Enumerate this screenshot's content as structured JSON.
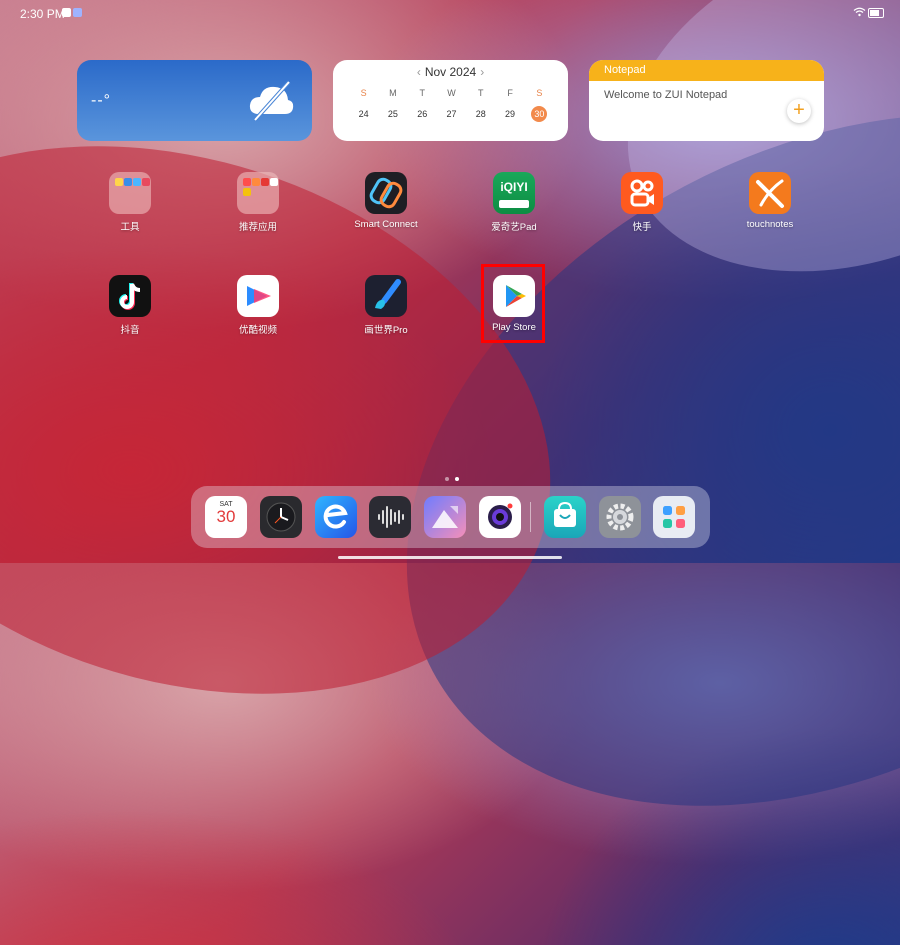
{
  "status_bar": {
    "time": "2:30 PM"
  },
  "weather_widget": {
    "temperature": "--°"
  },
  "calendar_widget": {
    "month_label": "Nov 2024",
    "weekdays": [
      "S",
      "M",
      "T",
      "W",
      "T",
      "F",
      "S"
    ],
    "days": [
      "24",
      "25",
      "26",
      "27",
      "28",
      "29",
      "30"
    ],
    "today": "30"
  },
  "notepad_widget": {
    "title": "Notepad",
    "body": "Welcome to ZUI Notepad",
    "add_label": "+"
  },
  "apps": [
    {
      "label": "工具",
      "icon": "tools-folder-icon"
    },
    {
      "label": "推荐应用",
      "icon": "recommended-apps-folder-icon"
    },
    {
      "label": "Smart Connect",
      "icon": "smart-connect-icon"
    },
    {
      "label": "爱奇艺Pad",
      "icon": "iqiyi-icon",
      "icon_text": "iQIYI"
    },
    {
      "label": "快手",
      "icon": "kuaishou-icon"
    },
    {
      "label": "touchnotes",
      "icon": "touchnotes-icon"
    },
    {
      "label": "抖音",
      "icon": "tiktok-icon"
    },
    {
      "label": "优酷视频",
      "icon": "youku-icon"
    },
    {
      "label": "画世界Pro",
      "icon": "paint-brush-icon"
    },
    {
      "label": "Play Store",
      "icon": "play-store-icon"
    }
  ],
  "dock": {
    "calendar_day_of_week": "SAT",
    "calendar_date": "30",
    "apps": [
      "calendar-icon",
      "clock-icon",
      "browser-icon",
      "voice-recorder-icon",
      "gallery-icon",
      "camera-icon",
      "app-store-icon",
      "settings-icon",
      "app-drawer-icon"
    ]
  },
  "colors": {
    "highlight": "#ff0000",
    "notepad_header": "#f7b21a",
    "today_circle": "#f28a4b",
    "weather_bg": "#2b6ac9"
  }
}
